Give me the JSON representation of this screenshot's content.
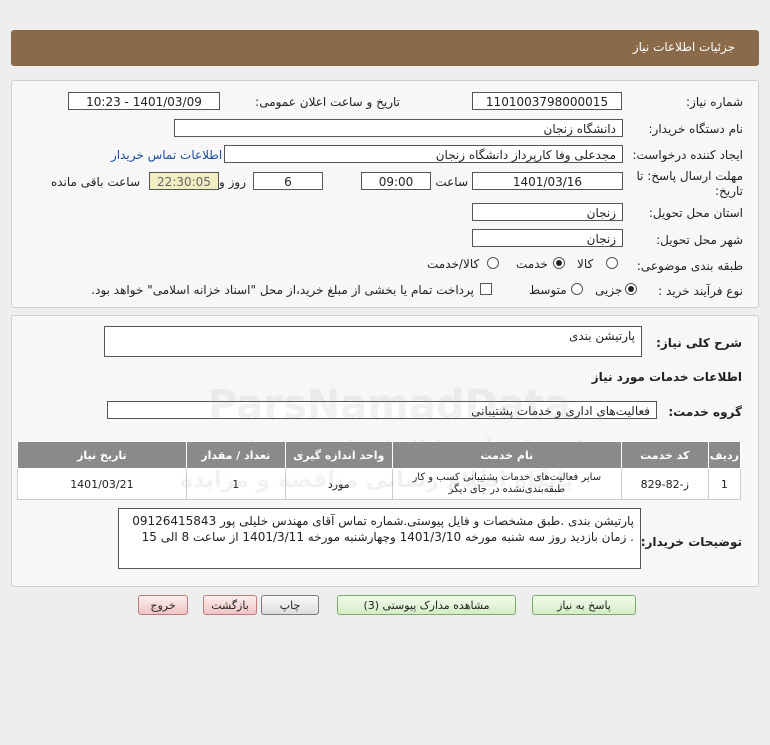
{
  "header": {
    "title": "جزئیات اطلاعات نیاز"
  },
  "details": {
    "need_number_label": "شماره نیاز:",
    "need_number": "1101003798000015",
    "announce_label": "تاریخ و ساعت اعلان عمومی:",
    "announce_value": "1401/03/09 - 10:23",
    "buyer_org_label": "نام دستگاه خریدار:",
    "buyer_org": "دانشگاه زنجان",
    "creator_label": "ایجاد کننده درخواست:",
    "creator": "مجدعلی وفا کارپرداز دانشگاه زنجان",
    "contact_link": "اطلاعات تماس خریدار",
    "deadline_label_1": "مهلت ارسال پاسخ: تا",
    "deadline_label_2": "تاریخ:",
    "deadline_date": "1401/03/16",
    "time_label": "ساعت",
    "deadline_time": "09:00",
    "days": "6",
    "days_label": "روز و",
    "remaining": "22:30:05",
    "remaining_label": "ساعت باقی مانده",
    "province_label": "استان محل تحویل:",
    "province": "زنجان",
    "city_label": "شهر محل تحویل:",
    "city": "زنجان",
    "category_label": "طبقه بندی موضوعی:",
    "category_options": [
      "کالا",
      "خدمت",
      "کالا/خدمت"
    ],
    "category_selected": "خدمت",
    "process_label": "نوع فرآیند خرید :",
    "process_options": [
      "جزیی",
      "متوسط"
    ],
    "process_selected": "جزیی",
    "payment_note": "پرداخت تمام یا بخشی از مبلغ خرید،از محل \"اسناد خزانه اسلامی\" خواهد بود."
  },
  "summary": {
    "need_desc_label": "شرح کلی نیاز:",
    "need_desc": "پارتیشن بندی",
    "services_title": "اطلاعات خدمات مورد نیاز",
    "service_group_label": "گروه خدمت:",
    "service_group": "فعالیت‌های اداری و خدمات پشتیبانی"
  },
  "table": {
    "headers": [
      "ردیف",
      "کد خدمت",
      "نام خدمت",
      "واحد اندازه گیری",
      "تعداد / مقدار",
      "تاریخ نیاز"
    ],
    "rows": [
      [
        "1",
        "ز-82-829",
        "سایر فعالیت‌های خدمات پشتیبانی کسب و کار طبقه‌بندی‌نشده در جای دیگر",
        "مورد",
        "1",
        "1401/03/21"
      ]
    ]
  },
  "buyer_notes": {
    "label": "توضیحات خریدار:",
    "text": "پارتیشن بندی .طبق مشخصات و فایل پیوستی.شماره تماس آقای مهندس خلیلی پور 09126415843 . زمان بازدید روز سه شنبه مورخه 1401/3/10 وچهارشنبه مورخه 1401/3/11 از ساعت 8 الی 15"
  },
  "buttons": {
    "reply": "پاسخ به نیاز",
    "attachments": "مشاهده مدارک پیوستی (3)",
    "print": "چاپ",
    "back": "بازگشت",
    "exit": "خروج"
  },
  "watermark": {
    "line1": "ParsNamadData",
    "line2": "مرکز فراهم آوری اطلاعات پارس نماد داده",
    "line3": "پایگاه اطلاع رسانی مناقصه و مزایده"
  },
  "colors": {
    "header": "#8b6a4a",
    "table_header": "#8a8a8a",
    "remaining_bg": "#f3eec1",
    "link": "#1a4f9c"
  }
}
